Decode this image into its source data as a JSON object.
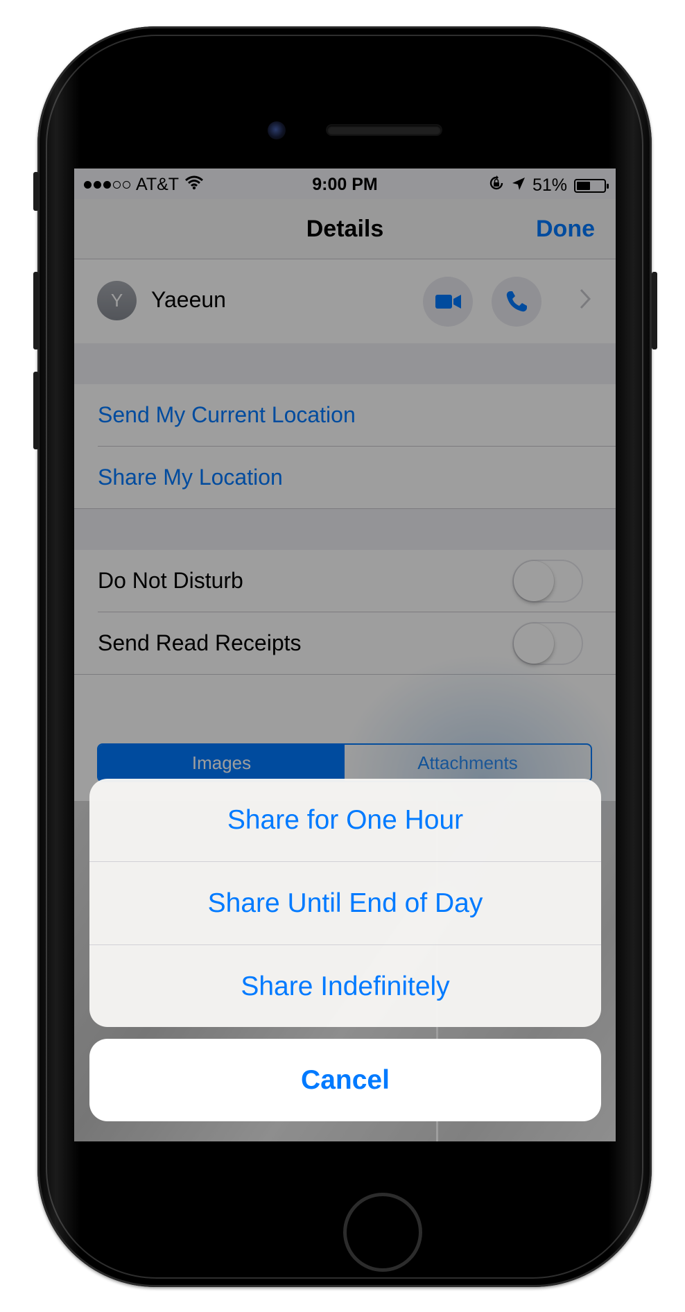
{
  "status_bar": {
    "signal_bars_filled": 3,
    "signal_bars_total": 5,
    "carrier": "AT&T",
    "time": "9:00 PM",
    "battery_percent": "51%",
    "battery_fill_fraction": 0.51
  },
  "nav": {
    "title": "Details",
    "done_label": "Done"
  },
  "contact": {
    "initial": "Y",
    "name": "Yaeeun",
    "icons": [
      "video-camera-icon",
      "phone-icon",
      "chevron-right-icon"
    ]
  },
  "location": {
    "send_current_label": "Send My Current Location",
    "share_label": "Share My Location"
  },
  "settings": {
    "do_not_disturb_label": "Do Not Disturb",
    "do_not_disturb_on": false,
    "read_receipts_label": "Send Read Receipts",
    "read_receipts_on": false
  },
  "segments": {
    "images_label": "Images",
    "attachments_label": "Attachments",
    "selected": "Images"
  },
  "action_sheet": {
    "options": [
      "Share for One Hour",
      "Share Until End of Day",
      "Share Indefinitely"
    ],
    "cancel_label": "Cancel"
  },
  "colors": {
    "accent": "#007aff",
    "dim_overlay": "rgba(0,0,0,0.38)"
  }
}
